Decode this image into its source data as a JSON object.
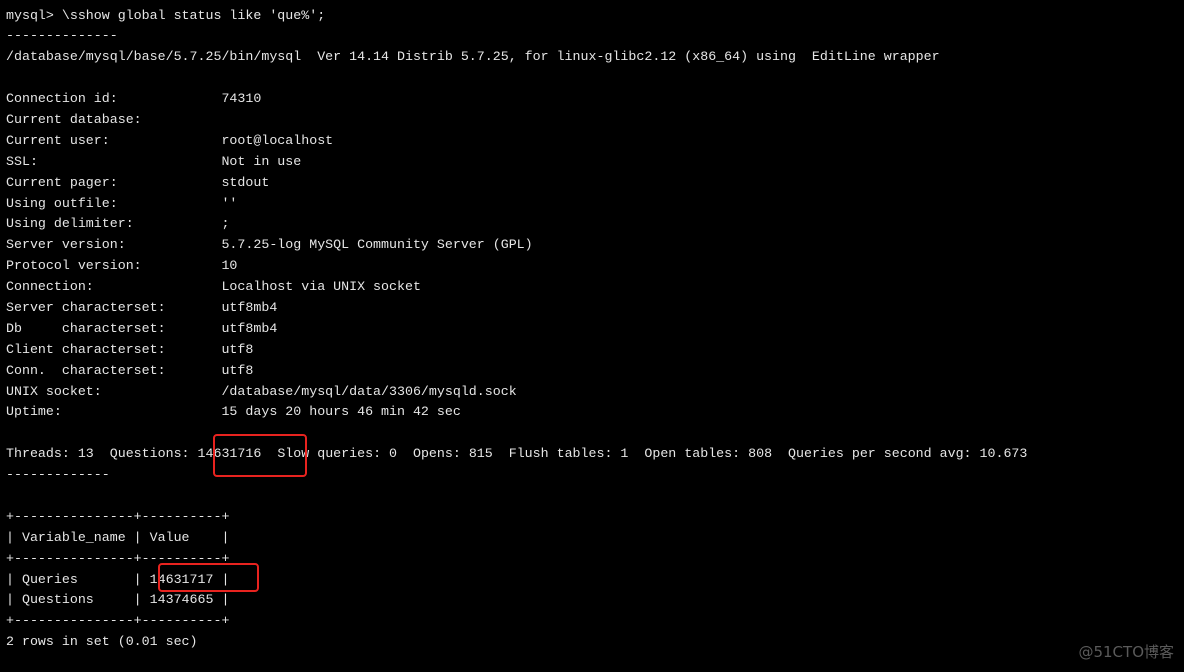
{
  "command": "mysql> \\sshow global status like 'que%';",
  "separator": "--------------",
  "version_line": "/database/mysql/base/5.7.25/bin/mysql  Ver 14.14 Distrib 5.7.25, for linux-glibc2.12 (x86_64) using  EditLine wrapper",
  "status_fields": [
    {
      "label": "Connection id:",
      "value": "74310"
    },
    {
      "label": "Current database:",
      "value": ""
    },
    {
      "label": "Current user:",
      "value": "root@localhost"
    },
    {
      "label": "SSL:",
      "value": "Not in use"
    },
    {
      "label": "Current pager:",
      "value": "stdout"
    },
    {
      "label": "Using outfile:",
      "value": "''"
    },
    {
      "label": "Using delimiter:",
      "value": ";"
    },
    {
      "label": "Server version:",
      "value": "5.7.25-log MySQL Community Server (GPL)"
    },
    {
      "label": "Protocol version:",
      "value": "10"
    },
    {
      "label": "Connection:",
      "value": "Localhost via UNIX socket"
    },
    {
      "label": "Server characterset:",
      "value": "utf8mb4"
    },
    {
      "label": "Db     characterset:",
      "value": "utf8mb4"
    },
    {
      "label": "Client characterset:",
      "value": "utf8"
    },
    {
      "label": "Conn.  characterset:",
      "value": "utf8"
    },
    {
      "label": "UNIX socket:",
      "value": "/database/mysql/data/3306/mysqld.sock"
    },
    {
      "label": "Uptime:",
      "value": "15 days 20 hours 46 min 42 sec"
    }
  ],
  "stats_line": {
    "prefix": "Threads: 13  Questions: ",
    "questions": "14631716",
    "suffix": "  Slow queries: 0  Opens: 815  Flush tables: 1  Open tables: 808  Queries per second avg: 10.673"
  },
  "separator2": "-------------",
  "table": {
    "border": "+---------------+----------+",
    "header": "| Variable_name | Value    |",
    "rows": [
      {
        "prefix": "| Queries       | ",
        "value": "14631717",
        "suffix": " |"
      },
      {
        "prefix": "| Questions     | ",
        "value": "14374665",
        "suffix": " |"
      }
    ]
  },
  "result_summary": "2 rows in set (0.01 sec)",
  "watermark": "@51CTO博客",
  "colors": {
    "text": "#e6e6e6",
    "background": "#000000",
    "highlight": "#e8231f"
  }
}
